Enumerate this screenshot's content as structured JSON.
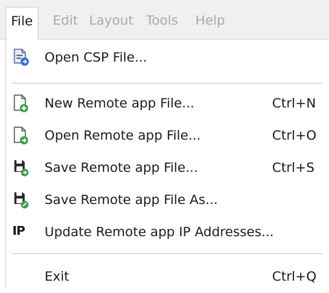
{
  "menubar": {
    "items": [
      {
        "label": "File",
        "active": true
      },
      {
        "label": "Edit",
        "active": false
      },
      {
        "label": "Layout",
        "active": false
      },
      {
        "label": "Tools",
        "active": false
      },
      {
        "label": "Help",
        "active": false
      }
    ]
  },
  "file_menu": {
    "items": [
      {
        "label": "Open CSP File...",
        "shortcut": "",
        "icon": "open-csp-file-icon"
      },
      {
        "label": "New Remote app File...",
        "shortcut": "Ctrl+N",
        "icon": "new-file-icon"
      },
      {
        "label": "Open Remote app File...",
        "shortcut": "Ctrl+O",
        "icon": "open-file-icon"
      },
      {
        "label": "Save Remote app File...",
        "shortcut": "Ctrl+S",
        "icon": "save-file-icon"
      },
      {
        "label": "Save Remote app File As...",
        "shortcut": "",
        "icon": "save-file-as-icon"
      },
      {
        "label": "Update Remote app IP Addresses...",
        "shortcut": "",
        "icon": "ip-icon",
        "icon_text": "IP"
      },
      {
        "label": "Exit",
        "shortcut": "Ctrl+Q",
        "icon": ""
      }
    ]
  },
  "colors": {
    "menubar_bg": "#f0f0f0",
    "disabled_text": "#a8a8a8",
    "text": "#1a1a1a",
    "icon_blue": "#2a6fd6",
    "icon_green": "#3aa047"
  }
}
